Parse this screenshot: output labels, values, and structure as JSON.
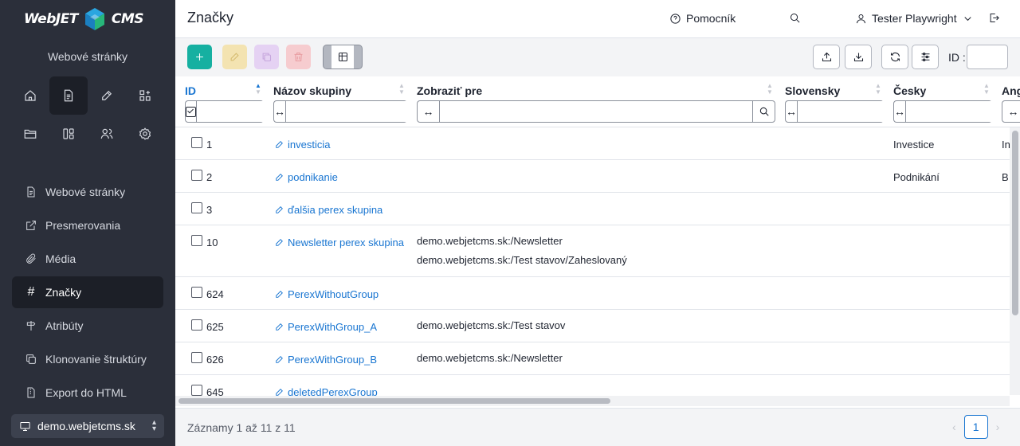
{
  "sidebar": {
    "logo": {
      "left": "WebJET",
      "right": "CMS"
    },
    "site_title": "Webové stránky",
    "icon_grid": [
      {
        "name": "home-icon",
        "active": false
      },
      {
        "name": "document-icon",
        "active": true
      },
      {
        "name": "edit-icon",
        "active": false
      },
      {
        "name": "apps-icon",
        "active": false
      },
      {
        "name": "folder-icon",
        "active": false
      },
      {
        "name": "columns-icon",
        "active": false
      },
      {
        "name": "users-icon",
        "active": false
      },
      {
        "name": "settings-icon",
        "active": false
      }
    ],
    "menu": [
      {
        "label": "Webové stránky",
        "icon": "document-icon"
      },
      {
        "label": "Presmerovania",
        "icon": "external-link-icon"
      },
      {
        "label": "Média",
        "icon": "paperclip-icon"
      },
      {
        "label": "Značky",
        "icon": "hash-icon",
        "active": true
      },
      {
        "label": "Atribúty",
        "icon": "signpost-icon"
      },
      {
        "label": "Klonovanie štruktúry",
        "icon": "copy-icon"
      },
      {
        "label": "Export do HTML",
        "icon": "file-zip-icon"
      }
    ],
    "domain": "demo.webjetcms.sk"
  },
  "header": {
    "title": "Značky",
    "help_label": "Pomocník",
    "user_name": "Tester Playwright"
  },
  "toolbar": {
    "id_label": "ID :",
    "id_value": ""
  },
  "table": {
    "columns": {
      "id": "ID",
      "name": "Názov skupiny",
      "show_for": "Zobraziť pre",
      "sk": "Slovensky",
      "cz": "Česky",
      "en": "Ang"
    },
    "rows": [
      {
        "id": "1",
        "name": "investicia",
        "show_for": [],
        "cz": "Investice",
        "en": "In"
      },
      {
        "id": "2",
        "name": "podnikanie",
        "show_for": [],
        "cz": "Podnikání",
        "en": "B"
      },
      {
        "id": "3",
        "name": "ďalšia perex skupina",
        "show_for": [],
        "cz": "",
        "en": ""
      },
      {
        "id": "10",
        "name": "Newsletter perex skupina",
        "show_for": [
          "demo.webjetcms.sk:/Newsletter",
          "demo.webjetcms.sk:/Test stavov/Zaheslovaný"
        ],
        "cz": "",
        "en": ""
      },
      {
        "id": "624",
        "name": "PerexWithoutGroup",
        "show_for": [],
        "cz": "",
        "en": ""
      },
      {
        "id": "625",
        "name": "PerexWithGroup_A",
        "show_for": [
          "demo.webjetcms.sk:/Test stavov"
        ],
        "cz": "",
        "en": ""
      },
      {
        "id": "626",
        "name": "PerexWithGroup_B",
        "show_for": [
          "demo.webjetcms.sk:/Newsletter"
        ],
        "cz": "",
        "en": ""
      },
      {
        "id": "645",
        "name": "deletedPerexGroup",
        "show_for": [],
        "cz": "",
        "en": ""
      }
    ]
  },
  "footer": {
    "records": "Záznamy 1 až 11 z 11",
    "page": "1"
  }
}
